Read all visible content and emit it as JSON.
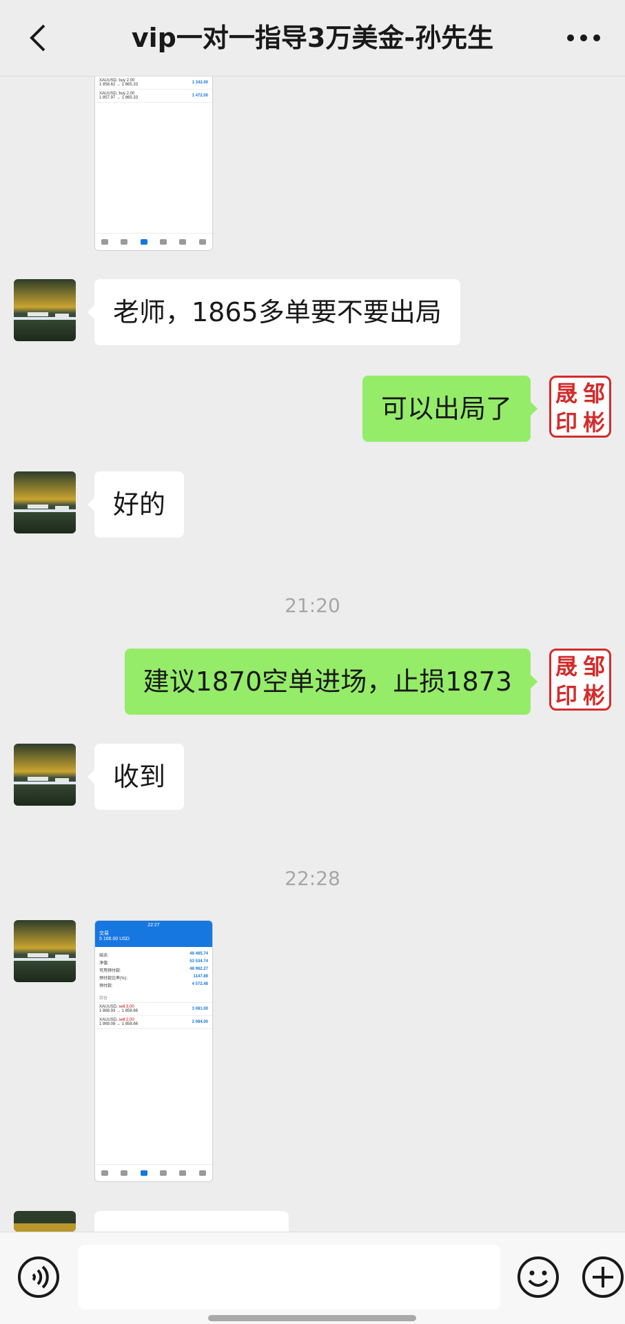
{
  "header": {
    "title": "vip一对一指导3万美金-孙先生",
    "back_icon": "chevron-left-icon",
    "more_icon": "more-dots-icon"
  },
  "messages": [
    {
      "type": "image",
      "side": "left",
      "desc_icon": "trade-screenshot",
      "rows": [
        {
          "sym": "XAUUSD, buy 2.00",
          "range": "1 858.62 → 1 865.33",
          "value": "1 342.00"
        },
        {
          "sym": "XAUUSD, buy 2.00",
          "range": "1 857.97 → 1 865.33",
          "value": "1 472.00"
        }
      ]
    },
    {
      "type": "text",
      "side": "left",
      "text": "老师，1865多单要不要出局"
    },
    {
      "type": "text",
      "side": "right",
      "text": "可以出局了"
    },
    {
      "type": "text",
      "side": "left",
      "text": "好的"
    },
    {
      "type": "time",
      "text": "21:20"
    },
    {
      "type": "text",
      "side": "right",
      "text": "建议1870空单进场，止损1873"
    },
    {
      "type": "text",
      "side": "left",
      "text": "收到"
    },
    {
      "type": "time",
      "text": "22:28"
    },
    {
      "type": "image",
      "side": "left",
      "status": "22:27",
      "title": "交易",
      "subtitle": "5 166.00 USD",
      "stats": [
        {
          "k": "结余:",
          "v": "48 465.74"
        },
        {
          "k": "净值:",
          "v": "53 534.74"
        },
        {
          "k": "可用预付款:",
          "v": "48 962.27"
        },
        {
          "k": "预付款比率(%):",
          "v": "1147.89"
        },
        {
          "k": "预付款:",
          "v": "4 572.48"
        }
      ],
      "section": "持仓",
      "rows": [
        {
          "sym": "XAUUSD,",
          "dir": "sell 3.00",
          "range": "1 868.93 → 1 858.66",
          "value": "3 081.00"
        },
        {
          "sym": "XAUUSD,",
          "dir": "sell 2.00",
          "range": "1 869.08 → 1 858.66",
          "value": "2 084.00"
        }
      ]
    }
  ],
  "seal": {
    "chars": [
      "晟",
      "邹",
      "印",
      "彬"
    ]
  },
  "footer": {
    "voice_icon": "voice-icon",
    "emoji_icon": "emoji-icon",
    "plus_icon": "plus-icon",
    "input_value": ""
  }
}
